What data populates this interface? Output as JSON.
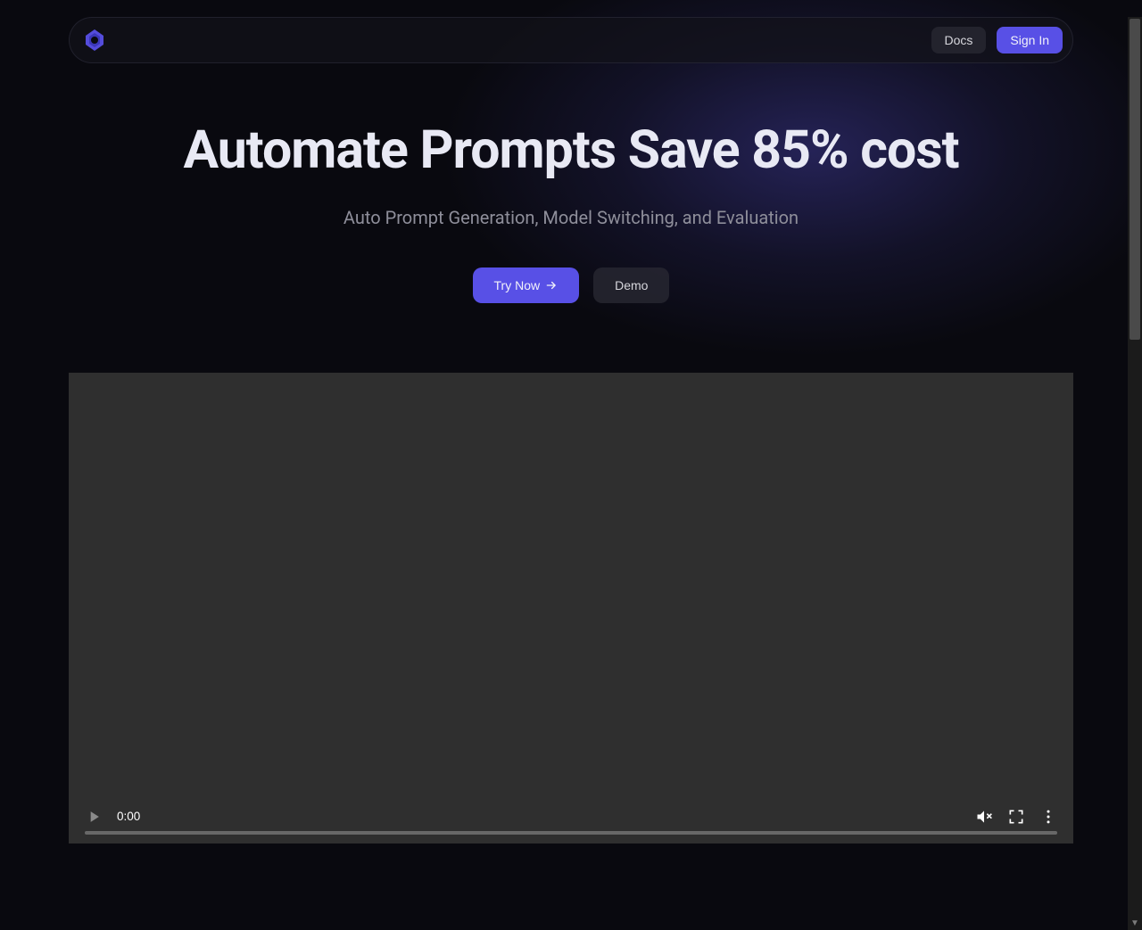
{
  "nav": {
    "docs_label": "Docs",
    "signin_label": "Sign In"
  },
  "hero": {
    "title": "Automate Prompts Save 85% cost",
    "subtitle": "Auto Prompt Generation, Model Switching, and Evaluation",
    "try_label": "Try Now",
    "demo_label": "Demo"
  },
  "video": {
    "time": "0:00"
  },
  "colors": {
    "accent": "#5850e6",
    "bg": "#09090f"
  }
}
